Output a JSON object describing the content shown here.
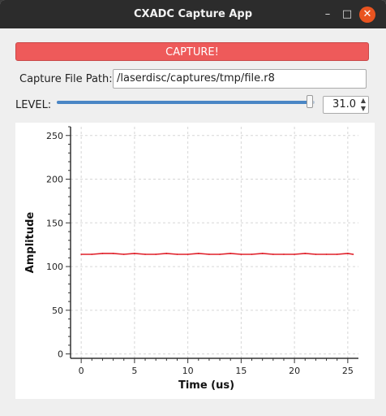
{
  "window": {
    "title": "CXADC Capture App",
    "min_glyph": "–",
    "max_glyph": "□",
    "close_glyph": "✕"
  },
  "capture": {
    "label": "CAPTURE!"
  },
  "path": {
    "label": "Capture File Path:",
    "value": "/laserdisc/captures/tmp/file.r8"
  },
  "level": {
    "label": "LEVEL:",
    "value": "31.0",
    "fraction": 0.98,
    "up_glyph": "▲",
    "down_glyph": "▼"
  },
  "colors": {
    "capture": "#ee5a5a",
    "slider": "#4a86c5",
    "signal": "#e0202a"
  },
  "chart_data": {
    "type": "line",
    "xlabel": "Time (us)",
    "ylabel": "Amplitude",
    "xlim": [
      -1,
      26
    ],
    "ylim": [
      -5,
      260
    ],
    "xticks": [
      0,
      5,
      10,
      15,
      20,
      25
    ],
    "yticks": [
      0,
      50,
      100,
      150,
      200,
      250
    ],
    "grid": true,
    "series": [
      {
        "x": [
          0,
          1,
          2,
          3,
          4,
          5,
          6,
          7,
          8,
          9,
          10,
          11,
          12,
          13,
          14,
          15,
          16,
          17,
          18,
          19,
          20,
          21,
          22,
          23,
          24,
          25,
          25.5
        ],
        "values": [
          114,
          114,
          115,
          115,
          114,
          115,
          114,
          114,
          115,
          114,
          114,
          115,
          114,
          114,
          115,
          114,
          114,
          115,
          114,
          114,
          114,
          115,
          114,
          114,
          114,
          115,
          114
        ]
      }
    ]
  }
}
